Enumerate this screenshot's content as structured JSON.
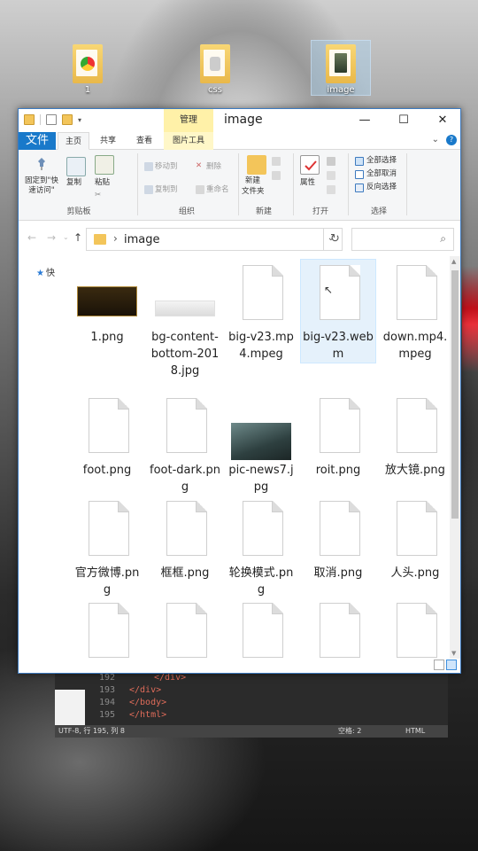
{
  "desktop": {
    "icons": [
      {
        "label": "1"
      },
      {
        "label": "css"
      },
      {
        "label": "image"
      }
    ]
  },
  "editor": {
    "line_numbers": [
      "192",
      "193",
      "194",
      "195"
    ],
    "lines": [
      "</div>",
      "</div>",
      "</body>",
      "</html>"
    ],
    "status_left": "UTF-8, 行 195, 列 8",
    "status_mid": "空格: 2",
    "status_right": "HTML"
  },
  "window": {
    "manage_tab": "管理",
    "title": "image",
    "min": "—",
    "max": "☐",
    "close": "✕",
    "tabs": {
      "file": "文件",
      "home": "主页",
      "share": "共享",
      "view": "查看",
      "picture_tools": "图片工具"
    },
    "ribbon": {
      "clipboard": {
        "pin": "固定到\"快速访问\"",
        "copy": "复制",
        "paste": "粘贴",
        "caption": "剪贴板"
      },
      "organize": {
        "move_to": "移动到",
        "copy_to": "复制到",
        "delete": "删除",
        "rename": "重命名",
        "caption": "组织"
      },
      "new": {
        "new_folder_1": "新建",
        "new_folder_2": "文件夹",
        "caption": "新建"
      },
      "open": {
        "properties": "属性",
        "caption": "打开"
      },
      "select": {
        "select_all": "全部选择",
        "select_none": "全部取消",
        "invert": "反向选择",
        "caption": "选择"
      }
    },
    "address": {
      "path": "image",
      "search_placeholder": ""
    },
    "navpane": {
      "quick_access": "快"
    },
    "files": [
      {
        "name": "1.png",
        "kind": "lol-logo"
      },
      {
        "name": "bg-content-bottom-2018.jpg",
        "kind": "grey-strip"
      },
      {
        "name": "big-v23.mp4.mpeg",
        "kind": "doc"
      },
      {
        "name": "big-v23.webm",
        "kind": "doc"
      },
      {
        "name": "down.mp4.mpeg",
        "kind": "doc"
      },
      {
        "name": "foot.png",
        "kind": "doc"
      },
      {
        "name": "foot-dark.png",
        "kind": "doc"
      },
      {
        "name": "pic-news7.jpg",
        "kind": "news-photo"
      },
      {
        "name": "roit.png",
        "kind": "doc"
      },
      {
        "name": "放大镜.png",
        "kind": "doc"
      },
      {
        "name": "官方微博.png",
        "kind": "doc"
      },
      {
        "name": "框框.png",
        "kind": "doc"
      },
      {
        "name": "轮换模式.png",
        "kind": "doc"
      },
      {
        "name": "取消.png",
        "kind": "doc"
      },
      {
        "name": "人头.png",
        "kind": "doc"
      },
      {
        "name": "",
        "kind": "doc"
      },
      {
        "name": "",
        "kind": "doc"
      },
      {
        "name": "",
        "kind": "doc"
      },
      {
        "name": "",
        "kind": "doc"
      },
      {
        "name": "",
        "kind": "doc"
      }
    ]
  }
}
